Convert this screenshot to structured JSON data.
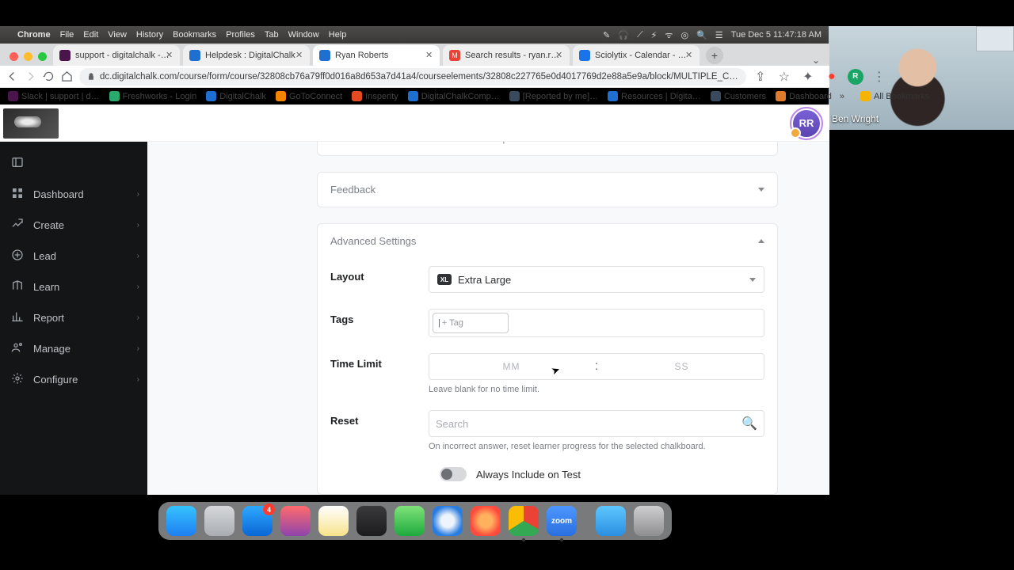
{
  "mac_menu": {
    "app": "Chrome",
    "items": [
      "File",
      "Edit",
      "View",
      "History",
      "Bookmarks",
      "Profiles",
      "Tab",
      "Window",
      "Help"
    ],
    "clock": "Tue Dec 5  11:47:18 AM"
  },
  "tabs": [
    {
      "label": "support - digitalchalk - Slack",
      "favtext": "",
      "favbg": "#4a154b"
    },
    {
      "label": "Helpdesk : DigitalChalk",
      "favtext": "",
      "favbg": "#1f6fd0"
    },
    {
      "label": "Ryan Roberts",
      "favtext": "",
      "favbg": "#1f6fd0",
      "active": true
    },
    {
      "label": "Search results - ryan.roberts…",
      "favtext": "M",
      "favbg": "#ea4335"
    },
    {
      "label": "Sciolytix - Calendar - Decemb…",
      "favtext": "",
      "favbg": "#1a73e8"
    }
  ],
  "omnibox": {
    "url": "dc.digitalchalk.com/course/form/course/32808cb76a79ff0d016a8d653a7d41a4/courseelements/32808c227765e0d4017769d2e88a5e9a/block/MULTIPLE_C…"
  },
  "bookmarks": [
    {
      "label": "Slack | support | d…",
      "fav": "#4a154b"
    },
    {
      "label": "Freshworks - Login",
      "fav": "#2aa96f"
    },
    {
      "label": "DigitalChalk",
      "fav": "#1f6fd0"
    },
    {
      "label": "GoToConnect",
      "fav": "#f58400"
    },
    {
      "label": "Insperity",
      "fav": "#e24b21"
    },
    {
      "label": "DigitalChalkComp…",
      "fav": "#1f6fd0"
    },
    {
      "label": "[Reported by me]…",
      "fav": "#394a5e"
    },
    {
      "label": "Resources | Digita…",
      "fav": "#1f6fd0"
    },
    {
      "label": "Customers",
      "fav": "#394a5e"
    },
    {
      "label": "Dashboard",
      "fav": "#e07b2d"
    }
  ],
  "bookmarks_more": "»",
  "bookmarks_all": "All Bookmarks",
  "profile_initials": "RR",
  "addr_profile_letter": "R",
  "sidebar": {
    "items": [
      {
        "label": "Dashboard"
      },
      {
        "label": "Create"
      },
      {
        "label": "Lead"
      },
      {
        "label": "Learn"
      },
      {
        "label": "Report"
      },
      {
        "label": "Manage"
      },
      {
        "label": "Configure"
      }
    ]
  },
  "points_hint": "Leave blank for no points awarded.",
  "sections": {
    "feedback": "Feedback",
    "advanced": "Advanced Settings"
  },
  "form": {
    "layout": {
      "label": "Layout",
      "value": "Extra Large",
      "chip": "XL"
    },
    "tags": {
      "label": "Tags",
      "placeholder": "+ Tag"
    },
    "timelimit": {
      "label": "Time Limit",
      "mm": "MM",
      "ss": "SS",
      "hint": "Leave blank for no time limit."
    },
    "reset": {
      "label": "Reset",
      "placeholder": "Search",
      "hint": "On incorrect answer, reset learner progress for the selected chalkboard."
    },
    "always": {
      "label": "Always Include on Test"
    }
  },
  "pip": {
    "name": "Ben Wright"
  },
  "dock": {
    "apps": [
      {
        "name": "finder",
        "bg": "linear-gradient(#35c3ff,#1e7ff0)"
      },
      {
        "name": "system-settings",
        "bg": "linear-gradient(#d6d8db,#a9adb2)"
      },
      {
        "name": "app-store",
        "bg": "linear-gradient(#2ea9ff,#0a66d6)",
        "badge": "4"
      },
      {
        "name": "launchpad",
        "bg": "linear-gradient(#ff6b6b,#8e44ad)"
      },
      {
        "name": "notes",
        "bg": "linear-gradient(#fff,#f7e38a)"
      },
      {
        "name": "calculator",
        "bg": "linear-gradient(#3a3a3c,#1c1c1e)"
      },
      {
        "name": "numbers",
        "bg": "linear-gradient(#7fe37a,#1eaa3d)"
      },
      {
        "name": "safari",
        "bg": "radial-gradient(circle,#eef4fb 30%,#2a7de0 70%)"
      },
      {
        "name": "firefox",
        "bg": "radial-gradient(circle,#ffb25e 30%,#ff4b3e 70%)"
      },
      {
        "name": "chrome",
        "bg": "conic-gradient(#ea4335 0 33%,#34a853 0 66%,#fbbc05 0),radial-gradient(circle,#4285f4 0 30%,#fff 31% 38%,transparent 39%)",
        "active": true
      },
      {
        "name": "zoom",
        "bg": "linear-gradient(#4d97ff,#2a6fe0)",
        "text": "zoom",
        "active": true
      }
    ],
    "tray": [
      {
        "name": "downloads",
        "bg": "linear-gradient(#5ec6ff,#2a8fe0)"
      },
      {
        "name": "trash",
        "bg": "linear-gradient(#cfcfd1,#8e8e91)"
      }
    ]
  }
}
